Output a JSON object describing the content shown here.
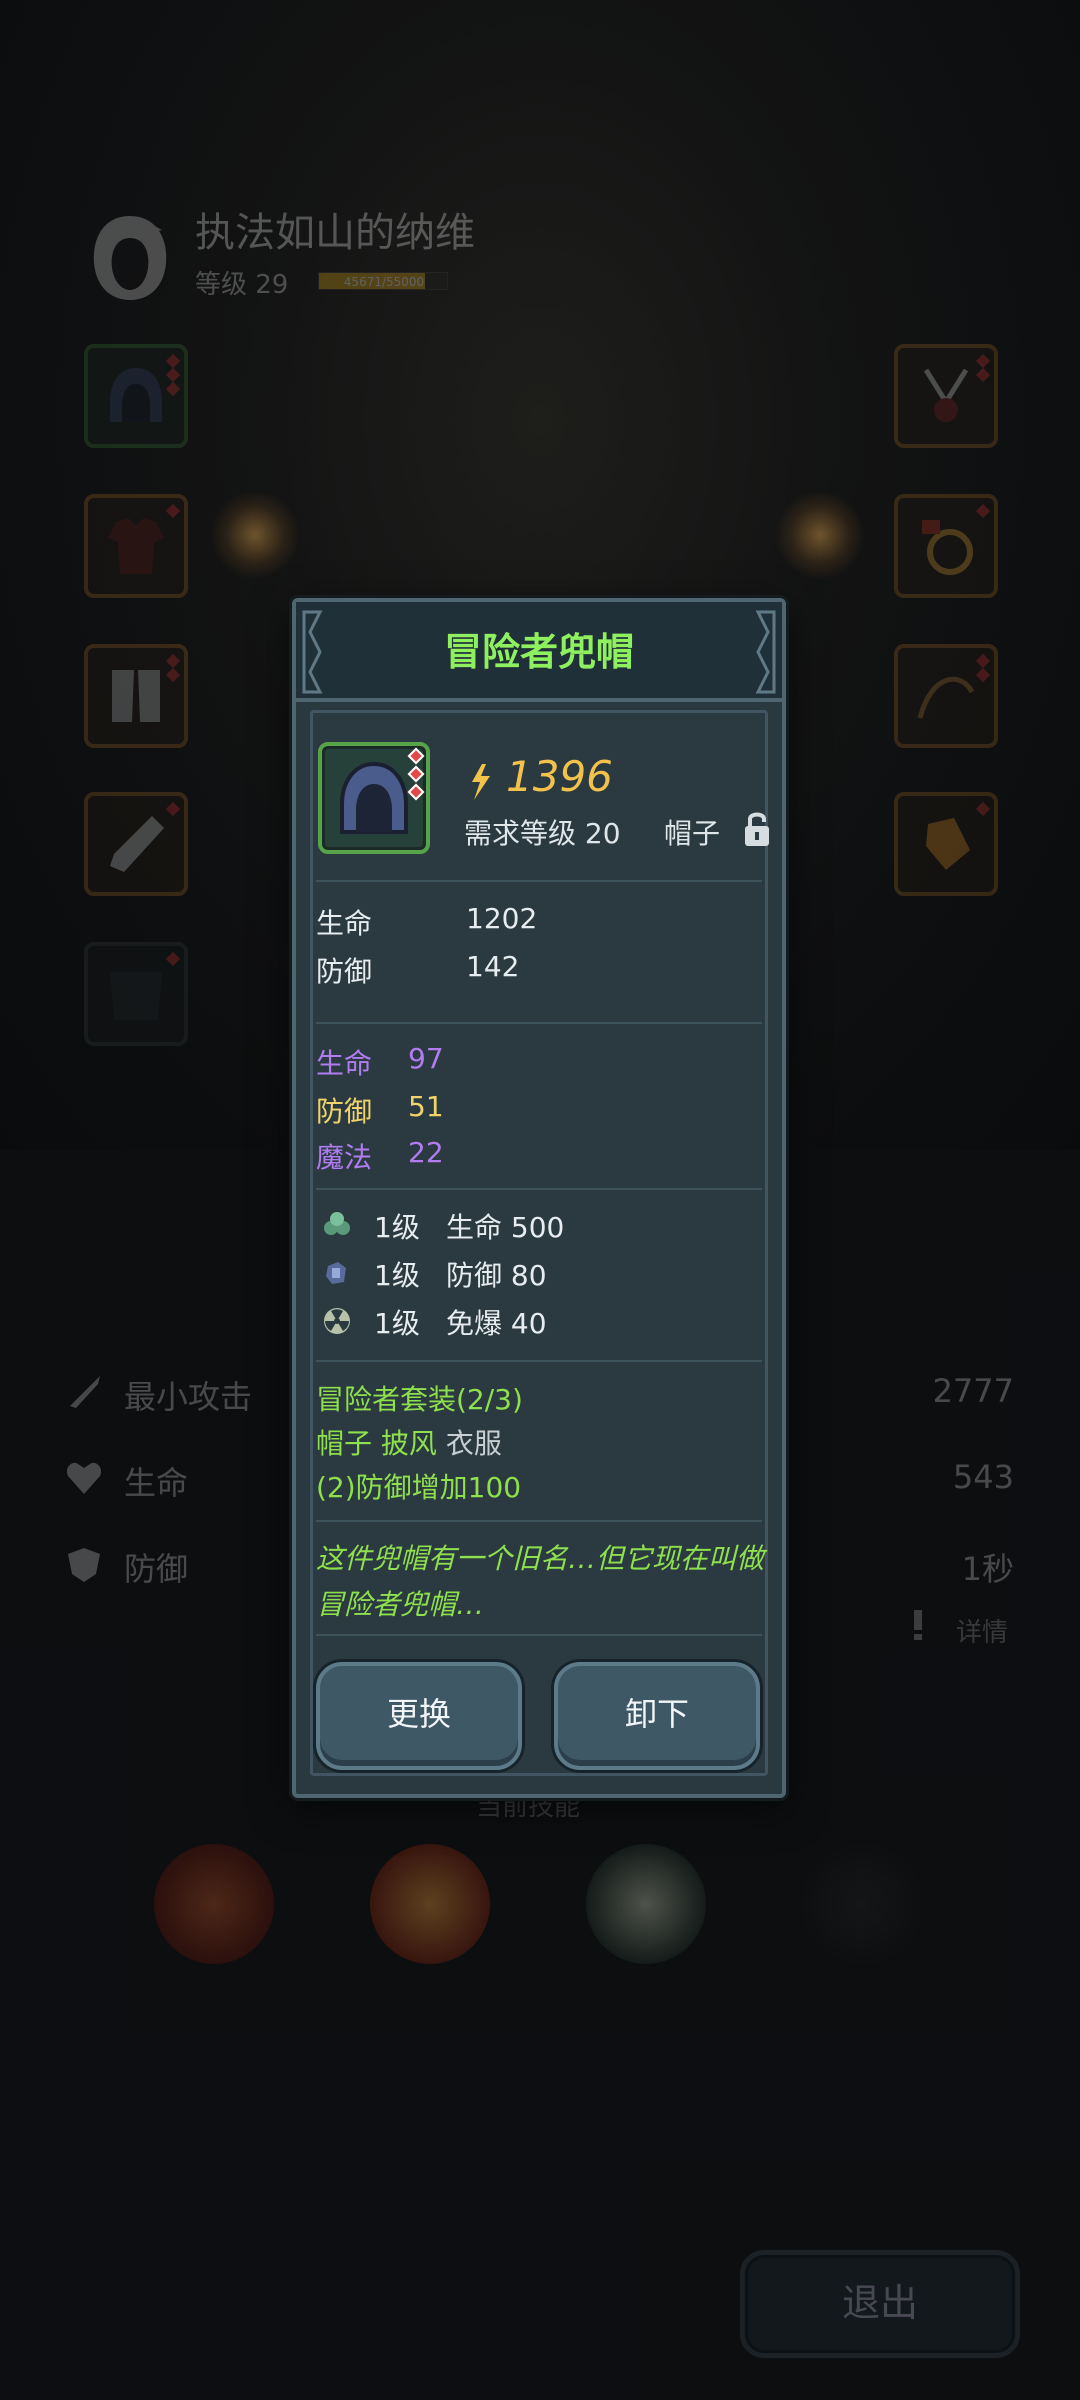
{
  "character": {
    "name": "执法如山的纳维",
    "level_label": "等级 29",
    "xp_text": "45671/55000",
    "xp_progress": 0.83
  },
  "stats": [
    {
      "label": "最小攻击",
      "value": "2777",
      "icon": "sword-icon"
    },
    {
      "label": "生命",
      "value": "543",
      "icon": "heart-icon"
    },
    {
      "label": "防御",
      "value": "1秒",
      "icon": "shield-icon"
    }
  ],
  "details_label": "详情",
  "skills_label": "当前技能",
  "exit_label": "退出",
  "popup": {
    "title": "冒险者兜帽",
    "power": "1396",
    "required_level": "需求等级 20",
    "slot_type": "帽子",
    "base_stats": [
      {
        "label": "生命",
        "value": "1202"
      },
      {
        "label": "防御",
        "value": "142"
      }
    ],
    "bonus_stats": [
      {
        "label": "生命",
        "value": "97",
        "color": "#b07cf0"
      },
      {
        "label": "防御",
        "value": "51",
        "color": "#f0d36a"
      },
      {
        "label": "魔法",
        "value": "22",
        "color": "#b07cf0"
      }
    ],
    "gems": [
      {
        "level": "1级",
        "stat": "生命 500",
        "icon": "green-gem-icon"
      },
      {
        "level": "1级",
        "stat": "防御 80",
        "icon": "blue-gem-icon"
      },
      {
        "level": "1级",
        "stat": "免爆 40",
        "icon": "radiation-gem-icon"
      }
    ],
    "set": {
      "name": "冒险者套装(2/3)",
      "pieces_owned": "帽子 披风",
      "pieces_missing": "衣服",
      "bonus": "(2)防御增加100"
    },
    "flavor": "这件兜帽有一个旧名…但它现在叫做冒险者兜帽…",
    "buttons": {
      "replace": "更换",
      "unequip": "卸下"
    }
  },
  "colors": {
    "title_green": "#8ef05e",
    "power_gold": "#f3c24b",
    "panel_bg": "#2a3940"
  }
}
